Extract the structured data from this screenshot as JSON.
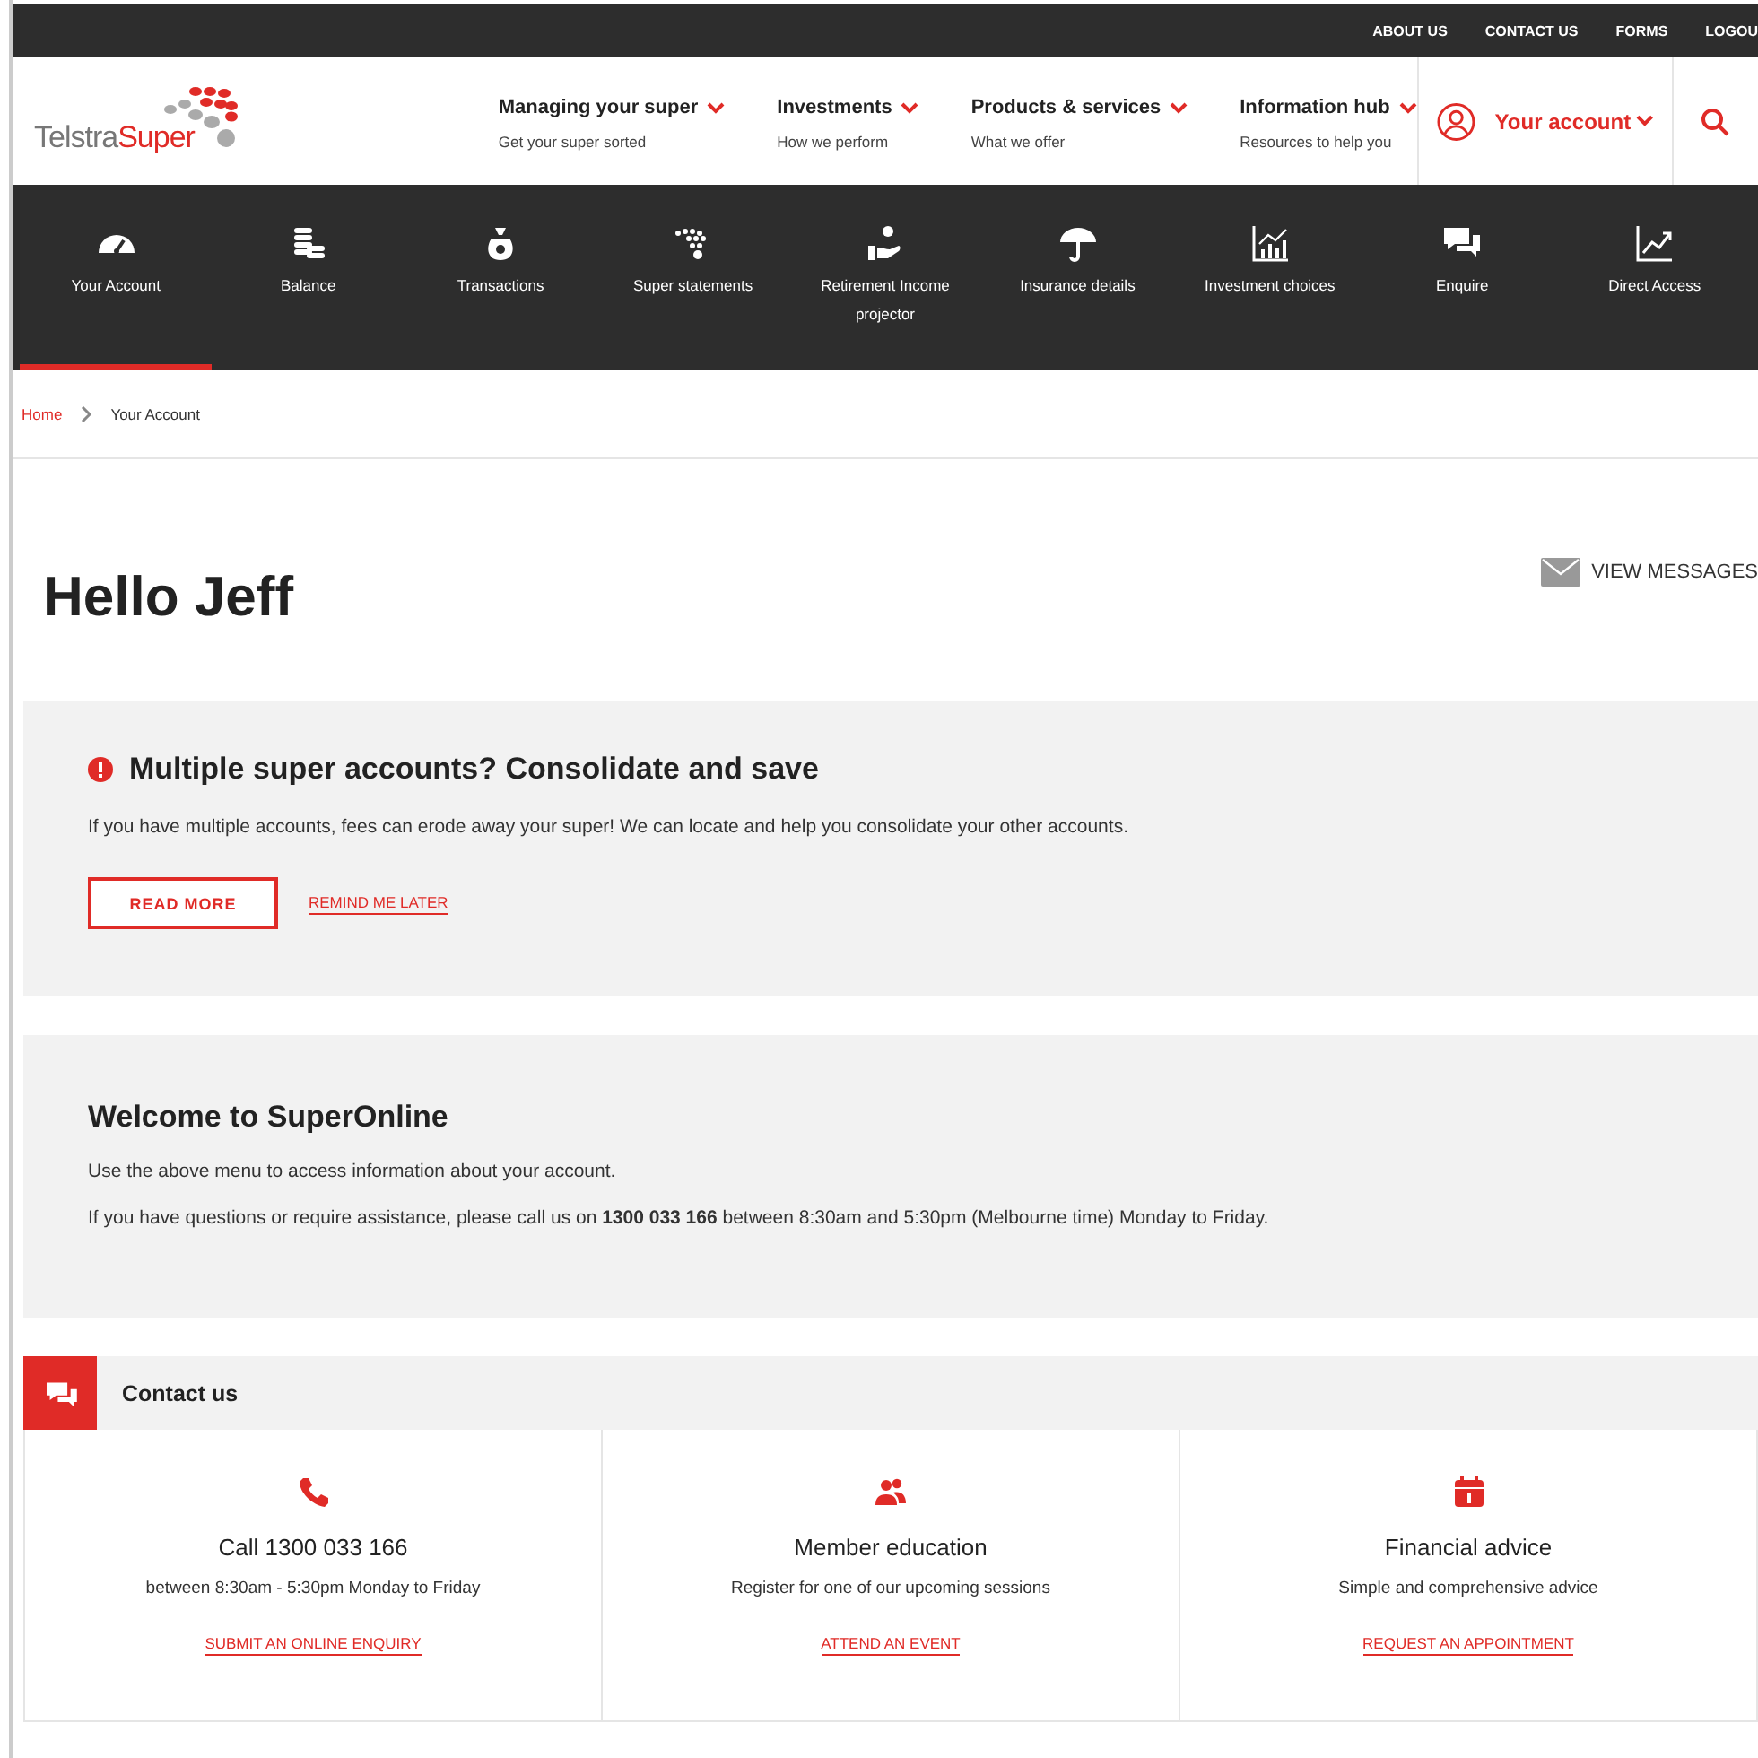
{
  "top_links": [
    "ABOUT US",
    "CONTACT US",
    "FORMS",
    "LOGOU"
  ],
  "logo": {
    "prefix": "Telstra",
    "suffix": "Super"
  },
  "main_menu": [
    {
      "label": "Managing your super",
      "sub": "Get your super sorted"
    },
    {
      "label": "Investments",
      "sub": "How we perform"
    },
    {
      "label": "Products & services",
      "sub": "What we offer"
    },
    {
      "label": "Information hub",
      "sub": "Resources to help you"
    }
  ],
  "account_menu": "Your account",
  "tabs": [
    {
      "label": "Your Account",
      "selected": true
    },
    {
      "label": "Balance",
      "selected": false
    },
    {
      "label": "Transactions",
      "selected": false
    },
    {
      "label": "Super statements",
      "selected": false
    },
    {
      "label": "Retirement Income projector",
      "selected": false
    },
    {
      "label": "Insurance details",
      "selected": false
    },
    {
      "label": "Investment choices",
      "selected": false
    },
    {
      "label": "Enquire",
      "selected": false
    },
    {
      "label": "Direct Access",
      "selected": false
    }
  ],
  "breadcrumb": [
    "Home",
    "Your Account"
  ],
  "greeting": "Hello Jeff",
  "messages_link": "VIEW MESSAGES",
  "alert": {
    "title": "Multiple super accounts? Consolidate and save",
    "text": "If you have multiple accounts, fees can erode away your super! We can locate and help you consolidate your other accounts.",
    "primary": "READ MORE",
    "secondary": "REMIND ME LATER"
  },
  "welcome": {
    "title": "Welcome to SuperOnline",
    "paragraphs": [
      "Use the above menu to access information about your account.",
      "If you have questions or require assistance, please call us on **1300 033 166** between 8:30am and 5:30pm (Melbourne time) Monday to Friday."
    ]
  },
  "contact": {
    "title": "Contact us",
    "cards": [
      {
        "kind": "phone",
        "title": "Call 1300 033 166",
        "text": "between 8:30am - 5:30pm Monday to Friday",
        "link": "SUBMIT AN ONLINE ENQUIRY"
      },
      {
        "kind": "people",
        "title": "Member education",
        "text": "Register for one of our upcoming sessions",
        "link": "ATTEND AN EVENT"
      },
      {
        "kind": "calendar",
        "title": "Financial advice",
        "text": "Simple and comprehensive advice",
        "link": "REQUEST AN APPOINTMENT"
      }
    ]
  }
}
